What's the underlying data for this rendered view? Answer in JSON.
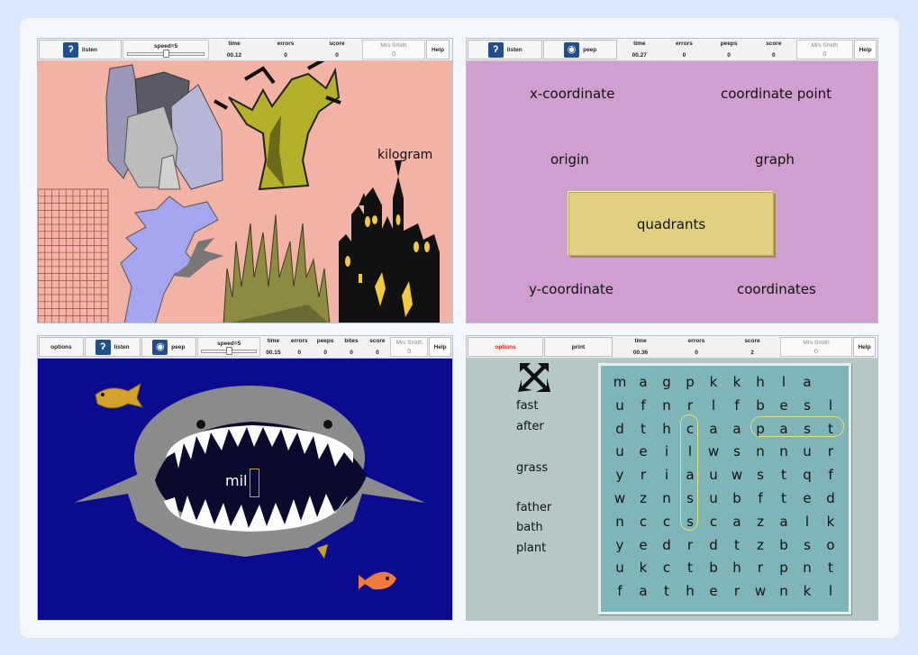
{
  "panel1": {
    "toolbar": {
      "listen": "listen",
      "speed": "speed=5",
      "speed_level": 5,
      "speed_max": 10,
      "time_label": "time",
      "time": "00.12",
      "errors_label": "errors",
      "errors": "0",
      "score_label": "score",
      "score": "0",
      "user": "Mrs Smith",
      "user_score": "0",
      "help": "Help"
    },
    "word": "kilogram",
    "background": "#f2b2a4"
  },
  "panel2": {
    "toolbar": {
      "listen": "listen",
      "peep": "peep",
      "time_label": "time",
      "time": "00.27",
      "errors_label": "errors",
      "errors": "0",
      "peeps_label": "peeps",
      "peeps": "0",
      "score_label": "score",
      "score": "0",
      "user": "Mrs Smith",
      "user_score": "0",
      "help": "Help"
    },
    "words": [
      "x-coordinate",
      "coordinate point",
      "origin",
      "graph",
      "quadrants",
      "y-coordinate",
      "coordinates"
    ],
    "background": "#cf9fd0",
    "highlight_color": "#e0d07f"
  },
  "panel3": {
    "toolbar": {
      "options": "options",
      "listen": "listen",
      "peep": "peep",
      "speed": "speed=5",
      "speed_level": 5,
      "speed_max": 10,
      "time_label": "time",
      "time": "00.15",
      "errors_label": "errors",
      "errors": "0",
      "peeps_label": "peeps",
      "peeps": "0",
      "bites_label": "bites",
      "bites": "0",
      "score_label": "score",
      "score": "0",
      "user": "Mrs Smith",
      "user_score": "0",
      "help": "Help"
    },
    "typed": "mil",
    "background": "#0b0b8f"
  },
  "panel4": {
    "toolbar": {
      "options": "options",
      "print": "print",
      "time_label": "time",
      "time": "00.36",
      "errors_label": "errors",
      "errors": "0",
      "score_label": "score",
      "score": "2",
      "user": "Mrs Smith",
      "user_score": "0",
      "help": "Help"
    },
    "wordlist": [
      "fast",
      "after",
      "grass",
      "father",
      "bath",
      "plant"
    ],
    "grid": [
      "magpkkhla",
      "ufnrlfbesl",
      "dthcaapast",
      "ueilwsnnur",
      "yriauwstqf",
      "wznsubfted",
      "nccscazalk",
      "yedrdtzbso",
      "ukctbhrpnt",
      "fatherwnkl"
    ],
    "background": "#b5c8c6",
    "grid_background": "#7fb4b8"
  }
}
